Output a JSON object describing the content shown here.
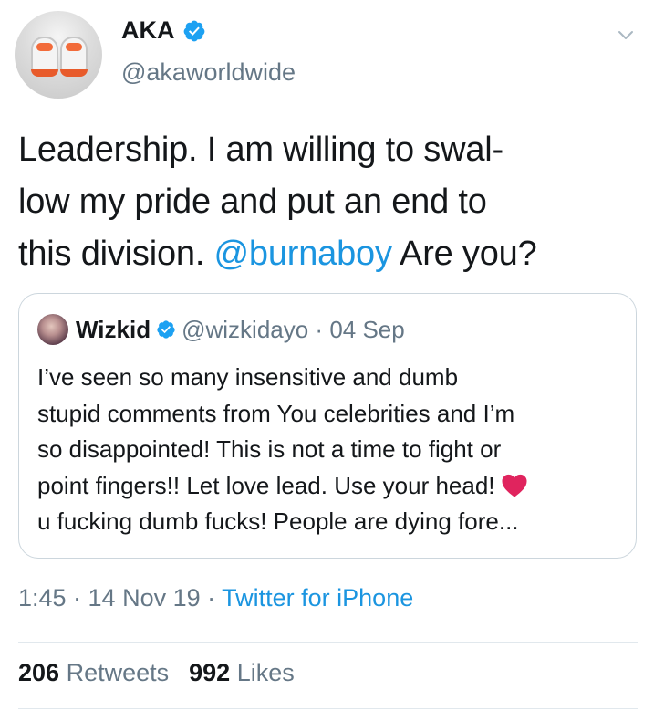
{
  "author": {
    "display_name": "AKA",
    "handle": "@akaworldwide",
    "verified": true
  },
  "tweet": {
    "text_before": "Leadership. I am willing to swal-low my pride and put an end to this division. ",
    "line1": "Leadership. I am willing to swal-",
    "line2": "low my pride and put an end to",
    "line3_pre": "this division. ",
    "mention": "@burnaboy",
    "line3_post": " Are you?"
  },
  "quoted": {
    "display_name": "Wizkid",
    "handle_date": "@wizkidayo · 04 Sep",
    "lines": [
      "I’ve seen so many insensitive and dumb",
      "stupid comments from You celebrities and I’m",
      "so disappointed! This is not a time to fight or",
      "point fingers!! Let love lead. Use your head!",
      "u fucking dumb fucks! People are dying fore..."
    ]
  },
  "meta": {
    "time_date": "1:45 · 14 Nov 19 · ",
    "source": "Twitter for iPhone"
  },
  "stats": {
    "retweets_count": "206",
    "retweets_label": "Retweets",
    "likes_count": "992",
    "likes_label": "Likes"
  },
  "icons": {
    "verified": "verified-badge-icon",
    "chevron": "chevron-down-icon",
    "heart": "red-heart-emoji-icon"
  },
  "colors": {
    "link": "#1b95e0",
    "secondary_text": "#657786",
    "primary_text": "#14171a",
    "border": "#ccd6dd"
  }
}
